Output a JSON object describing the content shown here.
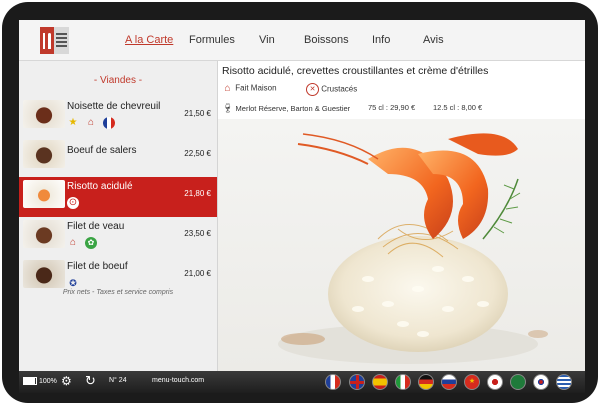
{
  "nav": [
    "A la Carte",
    "Formules",
    "Vin",
    "Boissons",
    "Info",
    "Avis"
  ],
  "category": "-   Viandes   -",
  "items": [
    {
      "name": "Noisette de chevreuil",
      "price": "21,50 €"
    },
    {
      "name": "Boeuf de salers",
      "price": "22,50 €"
    },
    {
      "name": "Risotto acidulé",
      "price": "21,80 €"
    },
    {
      "name": "Filet de veau",
      "price": "23,50 €"
    },
    {
      "name": "Filet de boeuf",
      "price": "21,00 €"
    }
  ],
  "disclaimer": "Prix nets - Taxes et service compris",
  "detail": {
    "title": "Risotto acidulé, crevettes croustillantes et crème d'étrilles",
    "tag1": "Fait Maison",
    "tag2": "Crustacés",
    "wine_name": "Merlot Réserve, Barton & Guestier",
    "wine_price_75": "75 cl : 29,90 €",
    "wine_price_12": "12.5 cl : 8,00 €"
  },
  "bottom": {
    "battery": "100%",
    "table_number": "N° 24",
    "site": "menu-touch.com"
  },
  "colors": {
    "accent": "#c8201c",
    "bar": "#2a2a2a"
  }
}
